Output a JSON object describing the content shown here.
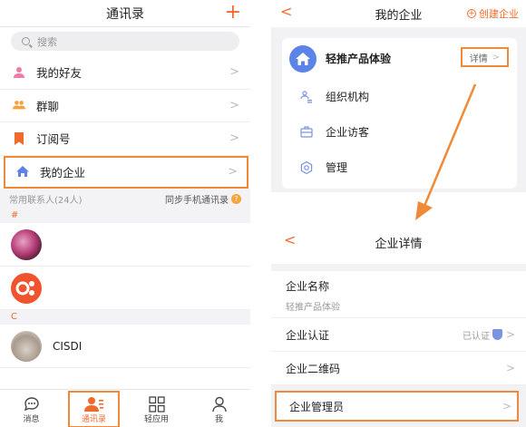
{
  "contacts_screen": {
    "title": "通讯录",
    "plus": "+",
    "search_placeholder": "搜索",
    "menu": [
      {
        "label": "我的好友",
        "icon": "person-icon"
      },
      {
        "label": "群聊",
        "icon": "group-icon"
      },
      {
        "label": "订阅号",
        "icon": "bookmark-icon"
      },
      {
        "label": "我的企业",
        "icon": "home-icon"
      }
    ],
    "section_label": "常用联系人(24人)",
    "sync_label": "同步手机通讯录",
    "sync_help": "?",
    "letters": [
      "#",
      "C"
    ],
    "contact_name": "CISDI",
    "tabs": [
      "消息",
      "通讯录",
      "轻应用",
      "我"
    ]
  },
  "enterprise_screen": {
    "back": "<",
    "title": "我的企业",
    "create_label": "创建企业",
    "org_name": "轻推产品体验",
    "detail_label": "详情",
    "items": [
      "组织机构",
      "企业访客",
      "管理"
    ]
  },
  "detail_screen": {
    "back": "<",
    "title": "企业详情",
    "name_label": "企业名称",
    "name_value": "轻推产品体验",
    "cert_label": "企业认证",
    "cert_value": "已认证",
    "qr_label": "企业二维码",
    "admin_label": "企业管理员"
  },
  "colors": {
    "accent": "#f06b2b",
    "highlight": "#f08a38",
    "brand_blue": "#5c83e8"
  }
}
